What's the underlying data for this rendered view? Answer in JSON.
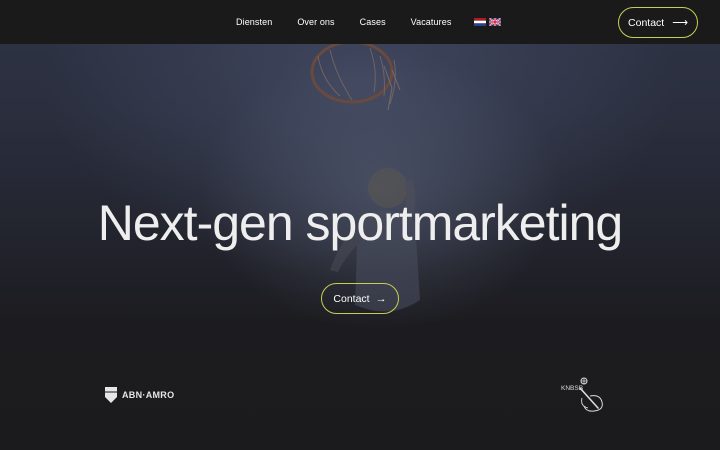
{
  "nav": {
    "links": [
      "Diensten",
      "Over ons",
      "Cases",
      "Vacatures"
    ],
    "languages": [
      "nl-flag-icon",
      "uk-flag-icon"
    ],
    "contact_label": "Contact",
    "contact_arrow": "⟶"
  },
  "hero": {
    "headline": "Next-gen sportmarketing",
    "cta_label": "Contact",
    "cta_arrow": "→"
  },
  "logos": {
    "abn_amro": "ABN·AMRO",
    "knbsb": "KNBSB"
  },
  "colors": {
    "accent_border": "#c7cf52",
    "nav_bg": "#1a1a1a",
    "page_bg": "#1b1b1d"
  }
}
